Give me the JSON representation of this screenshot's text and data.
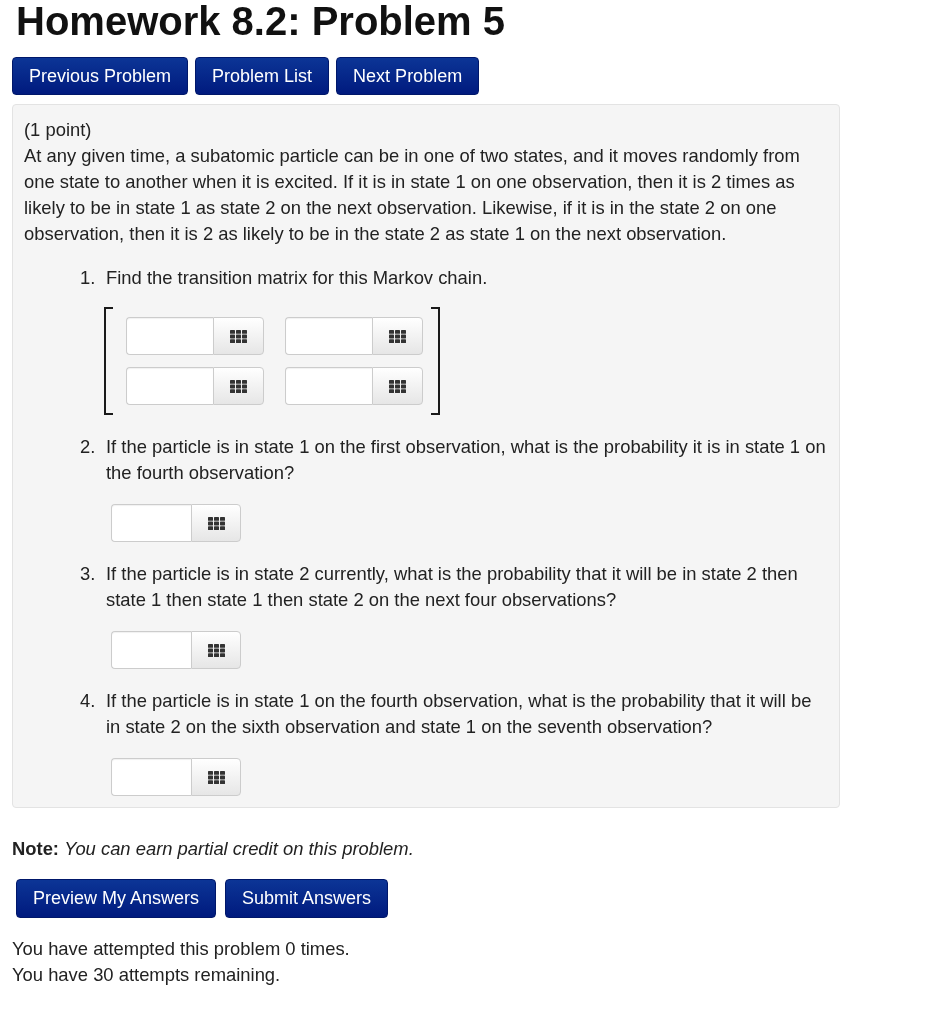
{
  "page": {
    "title": "Homework 8.2: Problem 5"
  },
  "nav_buttons": [
    {
      "label": "Previous Problem"
    },
    {
      "label": "Problem List"
    },
    {
      "label": "Next Problem"
    }
  ],
  "problem": {
    "points": "(1 point)",
    "statement": "At any given time, a subatomic particle can be in one of two states, and it moves randomly from one state to another when it is excited. If it is in state 1 on one observation, then it is 2 times as likely to be in state 1 as state 2 on the next observation. Likewise, if it is in the state 2 on one observation, then it is 2 as likely to be in the state 2 as state 1 on the next observation.",
    "questions": [
      {
        "number": "1.",
        "text": "Find the transition matrix for this Markov chain.",
        "kind": "matrix",
        "rows": [
          {
            "cells": [
              {
                "kind": "input"
              },
              {
                "kind": "input"
              }
            ]
          },
          {
            "cells": [
              {
                "kind": "input"
              },
              {
                "kind": "input"
              }
            ]
          }
        ]
      },
      {
        "number": "2.",
        "text": "If the particle is in state 1 on the first observation, what is the probability it is in state 1 on the fourth observation?",
        "kind": "input"
      },
      {
        "number": "3.",
        "text": "If the particle is in state 2 currently, what is the probability that it will be in state 2 then state 1 then state 1 then state 2 on the next four observations?",
        "kind": "input"
      },
      {
        "number": "4.",
        "text": "If the particle is in state 1 on the fourth observation, what is the probability that it will be in state 2 on the sixth observation and state 1 on the seventh observation?",
        "kind": "input"
      }
    ]
  },
  "note": "**Note:** *You can earn partial credit on this problem.*",
  "submit_buttons": [
    {
      "label": "Preview My Answers"
    },
    {
      "label": "Submit Answers"
    }
  ],
  "status": [
    "You have attempted this problem 0 times.",
    "You have 30 attempts remaining."
  ]
}
